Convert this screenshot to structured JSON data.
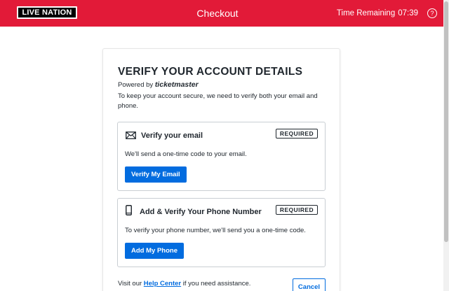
{
  "header": {
    "logo_text": "LIVE NATION",
    "title": "Checkout",
    "timer_label": "Time Remaining",
    "timer_value": "07:39",
    "help_icon": "question-circle-icon",
    "background_color": "#e21a38"
  },
  "card": {
    "heading": "VERIFY YOUR ACCOUNT DETAILS",
    "powered_by_label": "Powered by",
    "powered_by_brand": "ticketmaster",
    "description": "To keep your account secure, we need to verify both your email and phone."
  },
  "email_section": {
    "icon": "envelope-icon",
    "title": "Verify your email",
    "badge": "REQUIRED",
    "text": "We'll send a one-time code to your email.",
    "button_label": "Verify My Email"
  },
  "phone_section": {
    "icon": "mobile-phone-icon",
    "title": "Add & Verify Your Phone Number",
    "badge": "REQUIRED",
    "text": "To verify your phone number, we'll send you a one-time code.",
    "button_label": "Add My Phone"
  },
  "footer": {
    "help_prefix": "Visit our",
    "help_link": "Help Center",
    "help_suffix": "if you need assistance.",
    "cancel_label": "Cancel"
  },
  "colors": {
    "accent": "#026cdf",
    "brand_red": "#e21a38"
  }
}
